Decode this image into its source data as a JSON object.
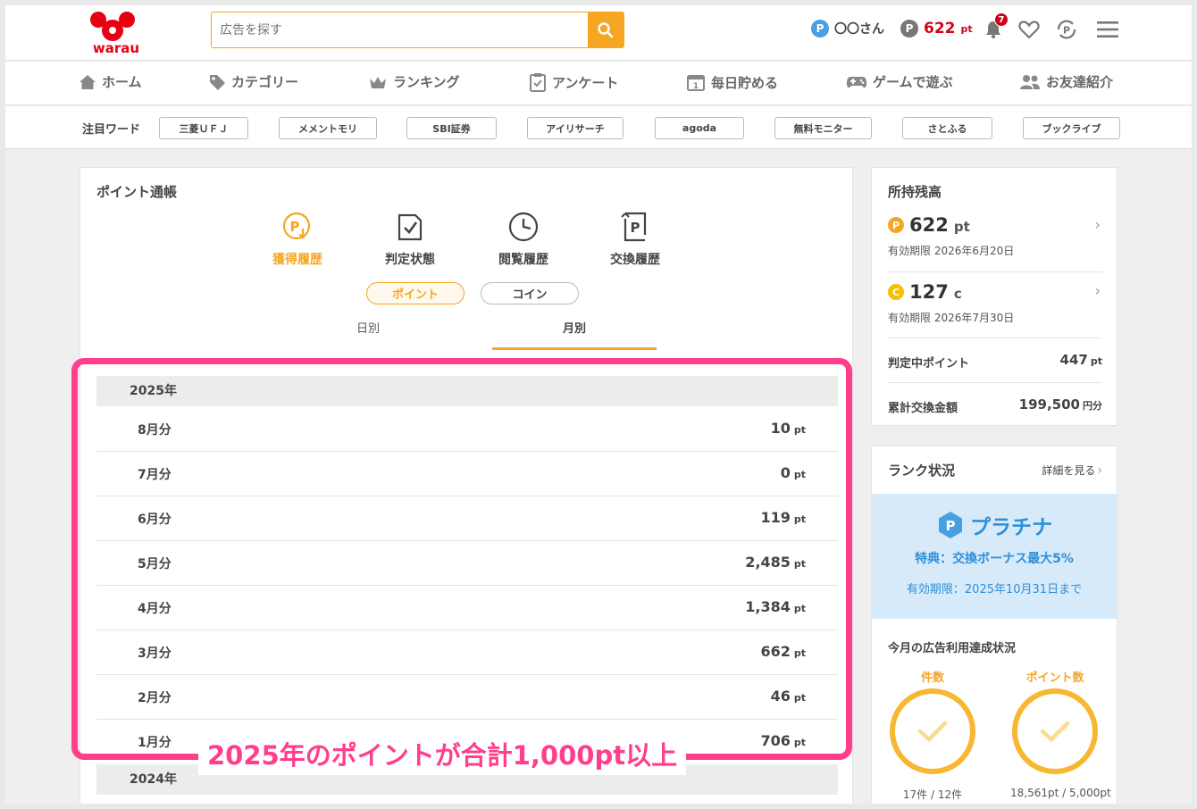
{
  "header": {
    "logo_text": "warau",
    "search_placeholder": "広告を探す",
    "user_name": "〇〇さん",
    "points": "622",
    "points_unit": "pt",
    "notification_count": "7"
  },
  "nav": {
    "items": [
      {
        "label": "ホーム",
        "icon": "home-icon"
      },
      {
        "label": "カテゴリー",
        "icon": "tag-icon"
      },
      {
        "label": "ランキング",
        "icon": "crown-icon"
      },
      {
        "label": "アンケート",
        "icon": "survey-icon"
      },
      {
        "label": "毎日貯める",
        "icon": "calendar-icon"
      },
      {
        "label": "ゲームで遊ぶ",
        "icon": "gamepad-icon"
      },
      {
        "label": "お友達紹介",
        "icon": "friends-icon"
      }
    ]
  },
  "trend": {
    "label": "注目ワード",
    "words": [
      "三菱ＵＦＪ",
      "メメントモリ",
      "SBI証券",
      "アイリサーチ",
      "agoda",
      "無料モニター",
      "さとふる",
      "ブックライブ"
    ]
  },
  "passbook": {
    "title": "ポイント通帳",
    "history_tabs": [
      "獲得履歴",
      "判定状態",
      "閲覧履歴",
      "交換履歴"
    ],
    "toggle": [
      "ポイント",
      "コイン"
    ],
    "sub_tabs": [
      "日別",
      "月別"
    ],
    "year_2025": "2025年",
    "months": [
      {
        "label": "8月分",
        "value": "10"
      },
      {
        "label": "7月分",
        "value": "0"
      },
      {
        "label": "6月分",
        "value": "119"
      },
      {
        "label": "5月分",
        "value": "2,485"
      },
      {
        "label": "4月分",
        "value": "1,384"
      },
      {
        "label": "3月分",
        "value": "662"
      },
      {
        "label": "2月分",
        "value": "46"
      },
      {
        "label": "1月分",
        "value": "706"
      }
    ],
    "unit": "pt",
    "year_2024": "2024年",
    "annotation": "2025年のポイントが合計1,000pt以上"
  },
  "balance": {
    "title": "所持残高",
    "point_amount": "622",
    "point_unit": "pt",
    "point_expiry": "有効期限 2026年6月20日",
    "coin_amount": "127",
    "coin_unit": "c",
    "coin_expiry": "有効期限 2026年7月30日",
    "pending_label": "判定中ポイント",
    "pending_value": "447",
    "pending_unit": "pt",
    "exchange_label": "累計交換金額",
    "exchange_value": "199,500",
    "exchange_unit": "円分"
  },
  "rank": {
    "title": "ランク状況",
    "detail_link": "詳細を見る",
    "rank_name": "プラチナ",
    "benefit": "特典：交換ボーナス最大5%",
    "expiry": "有効期限：2025年10月31日まで",
    "monthly_title": "今月の広告利用達成状況",
    "count_label": "件数",
    "count_value": "17件 / 12件",
    "points_label": "ポイント数",
    "points_value": "18,561pt / 5,000pt"
  },
  "colors": {
    "accent": "#f5a623",
    "highlight": "#ff3e8e",
    "points_red": "#d0021b",
    "platinum_bg": "#d6eafa"
  }
}
